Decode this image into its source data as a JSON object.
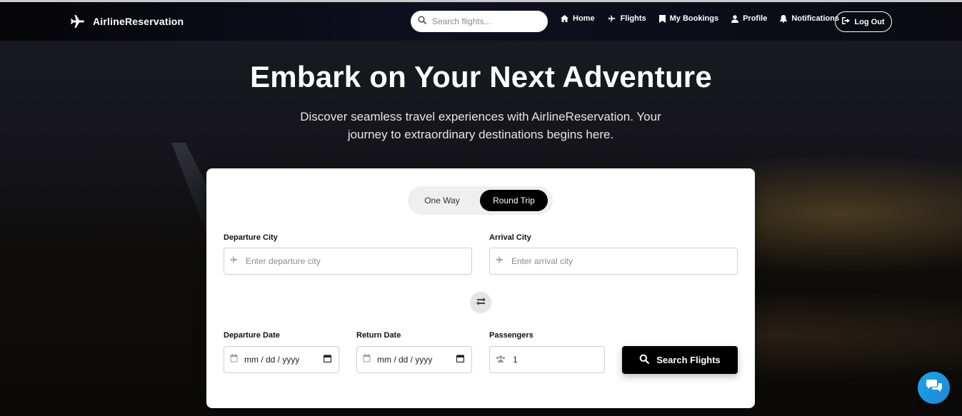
{
  "brand": {
    "name": "AirlineReservation"
  },
  "search": {
    "placeholder": "Search flights..."
  },
  "nav": {
    "items": [
      {
        "label": "Home",
        "icon": "home-icon"
      },
      {
        "label": "Flights",
        "icon": "plane-icon"
      },
      {
        "label": "My Bookings",
        "icon": "bookmark-icon"
      },
      {
        "label": "Profile",
        "icon": "user-icon"
      },
      {
        "label": "Notifications",
        "icon": "bell-icon"
      }
    ],
    "logout_label": "Log Out"
  },
  "hero": {
    "title": "Embark on Your Next Adventure",
    "subtitle": "Discover seamless travel experiences with AirlineReservation. Your journey to extraordinary destinations begins here."
  },
  "booking": {
    "trip_types": [
      "One Way",
      "Round Trip"
    ],
    "selected_trip_type": "Round Trip",
    "departure_city": {
      "label": "Departure City",
      "placeholder": "Enter departure city"
    },
    "arrival_city": {
      "label": "Arrival City",
      "placeholder": "Enter arrival city"
    },
    "departure_date": {
      "label": "Departure Date",
      "placeholder": "mm / dd / yyyy"
    },
    "return_date": {
      "label": "Return Date",
      "placeholder": "mm / dd / yyyy"
    },
    "passengers": {
      "label": "Passengers",
      "value": "1"
    },
    "search_button": "Search Flights"
  },
  "colors": {
    "accent_button": "#000000",
    "chat_button": "#1a9be6",
    "card_background": "#ffffff"
  }
}
